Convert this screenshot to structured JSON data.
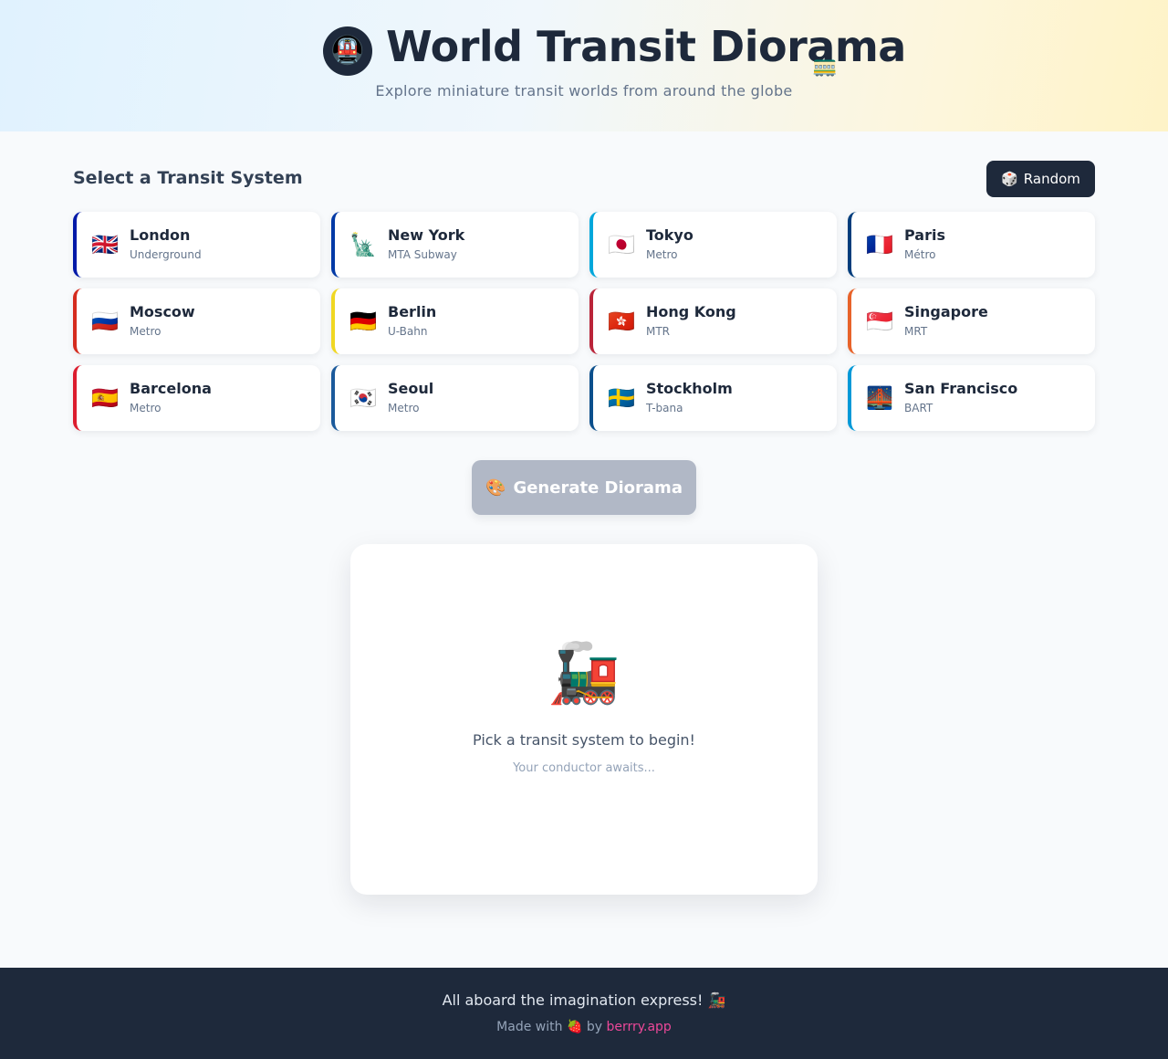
{
  "header": {
    "logo_icon": "🚇",
    "title": "World Transit Diorama",
    "title_deco_icon": "🚃",
    "subtitle": "Explore miniature transit worlds from around the globe"
  },
  "selector": {
    "title": "Select a Transit System",
    "random_icon": "🎲",
    "random_label": "Random"
  },
  "systems": [
    {
      "city": "London",
      "system": "Underground",
      "flag": "🇬🇧",
      "color": "#0019a8"
    },
    {
      "city": "New York",
      "system": "MTA Subway",
      "flag": "🗽",
      "color": "#0039a6"
    },
    {
      "city": "Tokyo",
      "system": "Metro",
      "flag": "🇯🇵",
      "color": "#00a7db"
    },
    {
      "city": "Paris",
      "system": "Métro",
      "flag": "🇫🇷",
      "color": "#003d7c"
    },
    {
      "city": "Moscow",
      "system": "Metro",
      "flag": "🇷🇺",
      "color": "#d52b1e"
    },
    {
      "city": "Berlin",
      "system": "U-Bahn",
      "flag": "🇩🇪",
      "color": "#f0d722"
    },
    {
      "city": "Hong Kong",
      "system": "MTR",
      "flag": "🇭🇰",
      "color": "#ba2439"
    },
    {
      "city": "Singapore",
      "system": "MRT",
      "flag": "🇸🇬",
      "color": "#e8632a"
    },
    {
      "city": "Barcelona",
      "system": "Metro",
      "flag": "🇪🇸",
      "color": "#dc1c2e"
    },
    {
      "city": "Seoul",
      "system": "Metro",
      "flag": "🇰🇷",
      "color": "#1b5a9b"
    },
    {
      "city": "Stockholm",
      "system": "T-bana",
      "flag": "🇸🇪",
      "color": "#0b4f8c"
    },
    {
      "city": "San Francisco",
      "system": "BART",
      "flag": "🌉",
      "color": "#0099d8"
    }
  ],
  "generate": {
    "icon": "🎨",
    "label": "Generate Diorama"
  },
  "canvas": {
    "icon": "🚂",
    "message": "Pick a transit system to begin!",
    "submessage": "Your conductor awaits..."
  },
  "footer": {
    "tagline": "All aboard the imagination express! 🚂",
    "made_with": "Made with",
    "heart_icon": "🍓",
    "by": "by",
    "link_text": "berrry.app"
  }
}
